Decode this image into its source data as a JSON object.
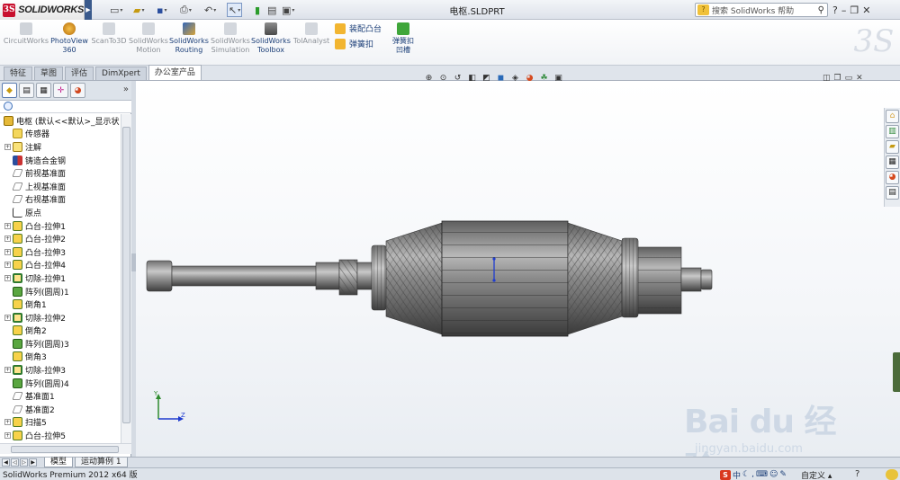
{
  "app": {
    "logo_text": "SOLIDWORKS",
    "doc_title": "电枢.SLDPRT"
  },
  "help_search": {
    "placeholder": "搜索 SolidWorks 帮助"
  },
  "commands": {
    "addins": [
      {
        "label": "CircuitWorks",
        "active": false
      },
      {
        "label": "PhotoView\n360",
        "active": true
      },
      {
        "label": "ScanTo3D",
        "active": false
      },
      {
        "label": "SolidWorks\nMotion",
        "active": false
      },
      {
        "label": "SolidWorks\nRouting",
        "active": true
      },
      {
        "label": "SolidWorks\nSimulation",
        "active": false
      },
      {
        "label": "SolidWorks\nToolbox",
        "active": true
      },
      {
        "label": "TolAnalyst",
        "active": false
      }
    ],
    "mount_boss": "装配凸台",
    "snap_hook": "弹簧扣",
    "snap_hook_groove": "弹簧扣\n凹槽"
  },
  "tabs": [
    "特征",
    "草图",
    "评估",
    "DimXpert",
    "办公室产品"
  ],
  "active_tab": 4,
  "feature_tree": [
    {
      "label": "电枢  (默认<<默认>_显示状态",
      "icon": "part-icon",
      "expand": "none",
      "indent": 0
    },
    {
      "label": "传感器",
      "icon": "sensor-icon",
      "expand": "none",
      "indent": 1
    },
    {
      "label": "注解",
      "icon": "annotation-icon",
      "expand": "plus",
      "indent": 1
    },
    {
      "label": "铸造合金钢",
      "icon": "material-icon",
      "expand": "none",
      "indent": 1
    },
    {
      "label": "前视基准面",
      "icon": "plane-icon",
      "expand": "none",
      "indent": 1
    },
    {
      "label": "上视基准面",
      "icon": "plane-icon",
      "expand": "none",
      "indent": 1
    },
    {
      "label": "右视基准面",
      "icon": "plane-icon",
      "expand": "none",
      "indent": 1
    },
    {
      "label": "原点",
      "icon": "origin-icon",
      "expand": "none",
      "indent": 1
    },
    {
      "label": "凸台-拉伸1",
      "icon": "boss-extrude-icon",
      "expand": "plus",
      "indent": 1
    },
    {
      "label": "凸台-拉伸2",
      "icon": "boss-extrude-icon",
      "expand": "plus",
      "indent": 1
    },
    {
      "label": "凸台-拉伸3",
      "icon": "boss-extrude-icon",
      "expand": "plus",
      "indent": 1
    },
    {
      "label": "凸台-拉伸4",
      "icon": "boss-extrude-icon",
      "expand": "plus",
      "indent": 1
    },
    {
      "label": "切除-拉伸1",
      "icon": "cut-extrude-icon",
      "expand": "plus",
      "indent": 1
    },
    {
      "label": "阵列(圆周)1",
      "icon": "circular-pattern-icon",
      "expand": "none",
      "indent": 1
    },
    {
      "label": "倒角1",
      "icon": "chamfer-icon",
      "expand": "none",
      "indent": 1
    },
    {
      "label": "切除-拉伸2",
      "icon": "cut-extrude-icon",
      "expand": "plus",
      "indent": 1
    },
    {
      "label": "倒角2",
      "icon": "chamfer-icon",
      "expand": "none",
      "indent": 1
    },
    {
      "label": "阵列(圆周)3",
      "icon": "circular-pattern-icon",
      "expand": "none",
      "indent": 1
    },
    {
      "label": "倒角3",
      "icon": "chamfer-icon",
      "expand": "none",
      "indent": 1
    },
    {
      "label": "切除-拉伸3",
      "icon": "cut-extrude-icon",
      "expand": "plus",
      "indent": 1
    },
    {
      "label": "阵列(圆周)4",
      "icon": "circular-pattern-icon",
      "expand": "none",
      "indent": 1
    },
    {
      "label": "基准面1",
      "icon": "plane-icon",
      "expand": "none",
      "indent": 1
    },
    {
      "label": "基准面2",
      "icon": "plane-icon",
      "expand": "none",
      "indent": 1
    },
    {
      "label": "扫描5",
      "icon": "sweep-icon",
      "expand": "plus",
      "indent": 1
    },
    {
      "label": "凸台-拉伸5",
      "icon": "boss-extrude-icon",
      "expand": "plus",
      "indent": 1
    }
  ],
  "triad": {
    "y": "Y",
    "z": "Z"
  },
  "watermark": {
    "brand": "Bai  du 经验",
    "url": "jingyan.baidu.com"
  },
  "model_tabs": [
    "模型",
    "运动算例 1"
  ],
  "active_model_tab": 0,
  "status": {
    "message": "SolidWorks Premium 2012 x64 版",
    "ime_label": "中",
    "customize": "自定义"
  },
  "colors": {
    "accent": "#c8102e",
    "selection": "#1f3ccf",
    "part_steel": "#8c8c8c"
  }
}
